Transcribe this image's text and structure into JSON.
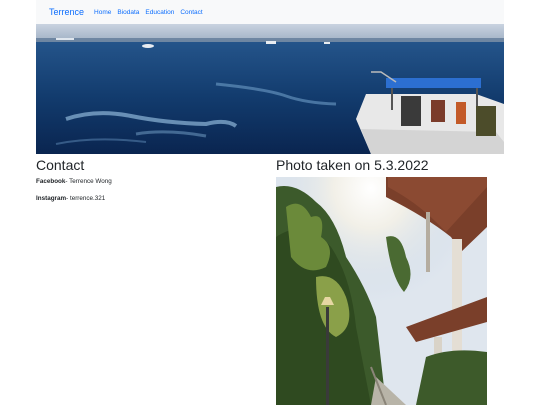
{
  "navbar": {
    "brand": "Terrence",
    "links": [
      "Home",
      "Biodata",
      "Education",
      "Contact"
    ]
  },
  "hero": {
    "image": "sea-boat-photo"
  },
  "contact": {
    "title": "Contact",
    "facebook_label": "Facebook",
    "facebook_value": "- Terrence Wong",
    "instagram_label": "Instagram",
    "instagram_value": "- terrence.321"
  },
  "photo": {
    "title": "Photo taken on 5.3.2022",
    "image": "forest-stairs-photo"
  }
}
